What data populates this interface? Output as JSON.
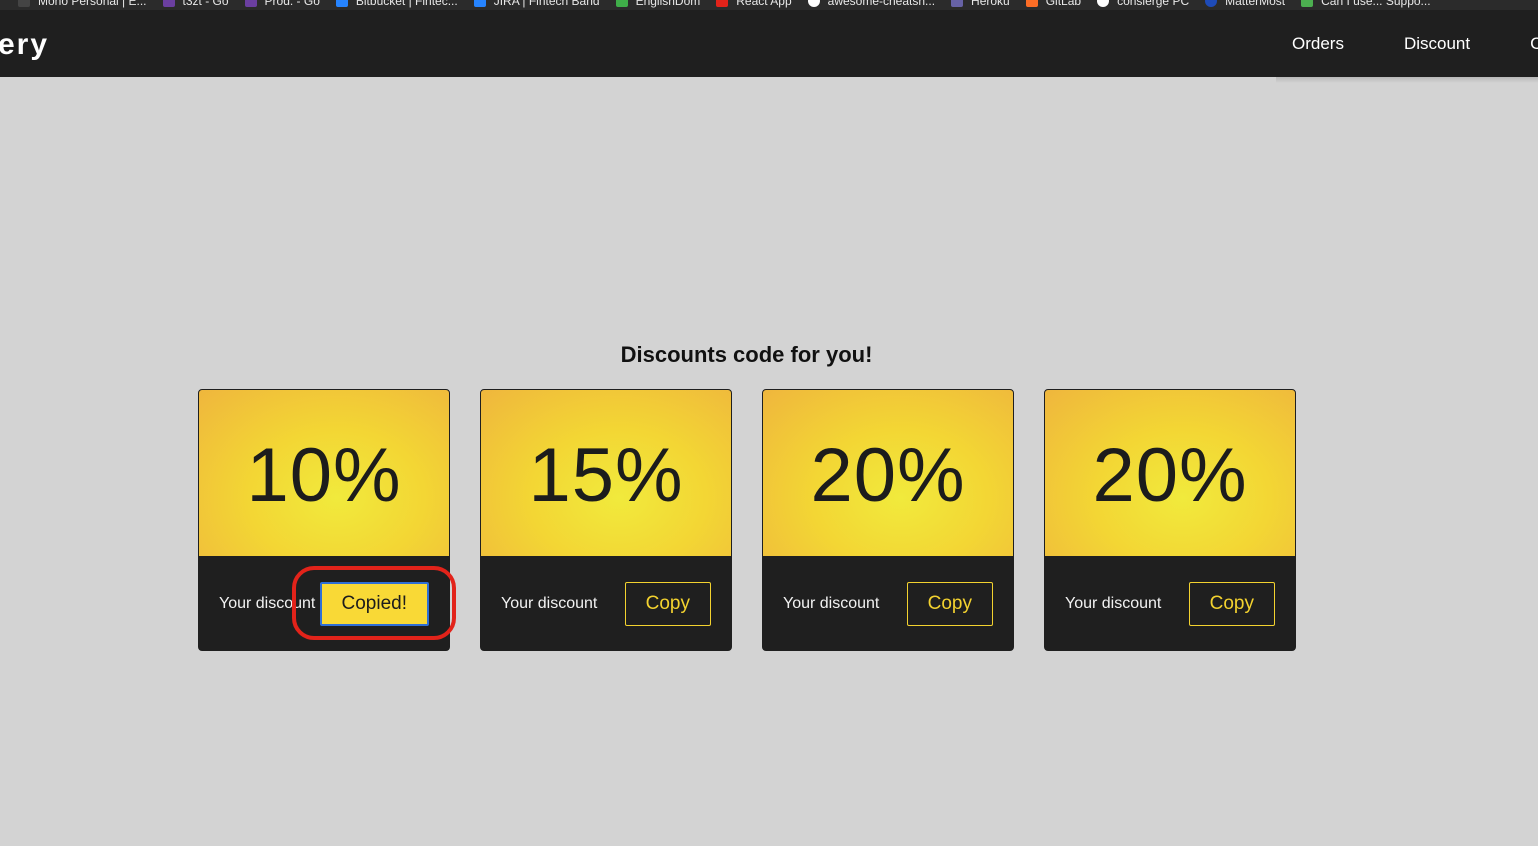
{
  "bookmarks": [
    {
      "label": "Mono Personal | E...",
      "icon": "mono-icon",
      "color": "#444444"
    },
    {
      "label": "t3zt - Go",
      "icon": "go-play-icon",
      "color": "#6b3fa0"
    },
    {
      "label": "Prod. - Go",
      "icon": "go-play-icon",
      "color": "#6b3fa0"
    },
    {
      "label": "Bitbucket | Fintec...",
      "icon": "bitbucket-icon",
      "color": "#2684ff"
    },
    {
      "label": "JIRA | Fintech Band",
      "icon": "jira-icon",
      "color": "#2684ff"
    },
    {
      "label": "EnglishDom",
      "icon": "englishdom-icon",
      "color": "#3fae49"
    },
    {
      "label": "React App",
      "icon": "react-app-icon",
      "color": "#e2231a"
    },
    {
      "label": "awesome-cheatsh...",
      "icon": "github-icon",
      "color": "#ffffff"
    },
    {
      "label": "Heroku",
      "icon": "heroku-icon",
      "color": "#6762a6"
    },
    {
      "label": "GitLab",
      "icon": "gitlab-icon",
      "color": "#fc6d26"
    },
    {
      "label": "consierge PC",
      "icon": "concierge-icon",
      "color": "#ffffff"
    },
    {
      "label": "MatterMost",
      "icon": "mattermost-icon",
      "color": "#1e4bb8"
    },
    {
      "label": "Can I use... Suppo...",
      "icon": "caniuse-icon",
      "color": "#4caf50"
    }
  ],
  "navbar": {
    "brand": "ery",
    "links": [
      "Orders",
      "Discount",
      "C"
    ]
  },
  "page": {
    "heading": "Discounts code for you!"
  },
  "cards": [
    {
      "percent": "10%",
      "caption": "Your discount",
      "button": "Copied!",
      "state": "copied"
    },
    {
      "percent": "15%",
      "caption": "Your discount",
      "button": "Copy",
      "state": "idle"
    },
    {
      "percent": "20%",
      "caption": "Your discount",
      "button": "Copy",
      "state": "idle"
    },
    {
      "percent": "20%",
      "caption": "Your discount",
      "button": "Copy",
      "state": "idle"
    }
  ],
  "colors": {
    "accent_yellow": "#f3d22f",
    "card_dark": "#1f1f1f",
    "background": "#d3d3d3",
    "annotation_red": "#e2231a"
  }
}
